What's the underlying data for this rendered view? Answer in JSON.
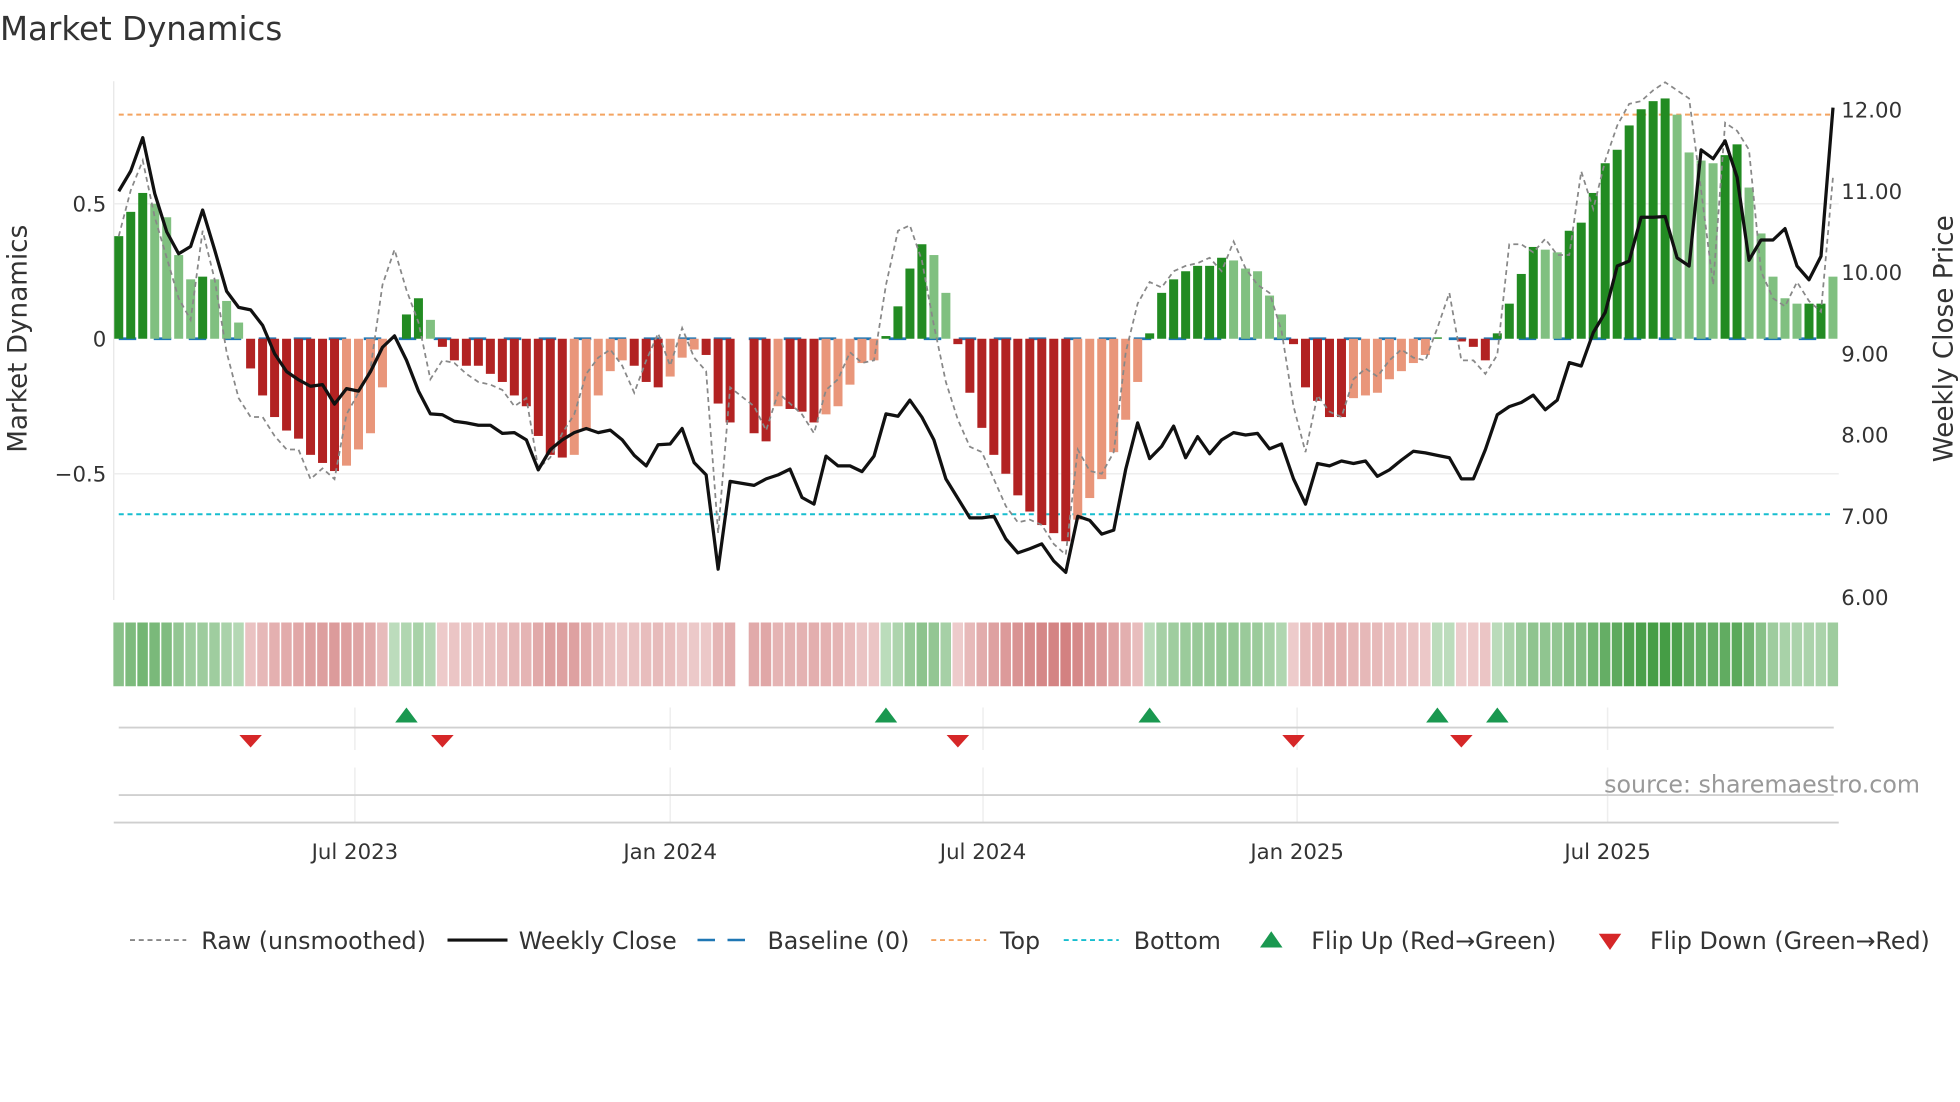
{
  "title": "Market Dynamics",
  "source_note": "source: sharemaestro.com",
  "colors": {
    "strong_up": "#228b22",
    "weak_up": "#80c080",
    "strong_down": "#b22222",
    "weak_down": "#e9967a",
    "raw": "#888888",
    "close": "#111111",
    "baseline": "#1f77b4",
    "top": "#f4a460",
    "bottom": "#17becf",
    "flip_up": "#1a9850",
    "flip_down": "#d62728"
  },
  "legend": {
    "raw": "Raw (unsmoothed)",
    "close": "Weekly Close",
    "baseline": "Baseline (0)",
    "top": "Top",
    "bottom": "Bottom",
    "flip_up": "Flip Up (Red→Green)",
    "flip_down": "Flip Down (Green→Red)"
  },
  "chart_data": {
    "type": "bar",
    "title": "Market Dynamics",
    "ylabel": "Market Dynamics",
    "y2label": "Weekly Close Price",
    "ylim": [
      -0.97,
      0.95
    ],
    "y2lim": [
      6.0,
      12.4
    ],
    "yticks": [
      {
        "v": 0.5,
        "label": "0.5"
      },
      {
        "v": 0,
        "label": "0"
      },
      {
        "v": -0.5,
        "label": "−0.5"
      }
    ],
    "y2ticks": [
      {
        "v": 12,
        "label": "12.00"
      },
      {
        "v": 11,
        "label": "11.00"
      },
      {
        "v": 10,
        "label": "10.00"
      },
      {
        "v": 9,
        "label": "9.00"
      },
      {
        "v": 8,
        "label": "8.00"
      },
      {
        "v": 7,
        "label": "7.00"
      },
      {
        "v": 6,
        "label": "6.00"
      }
    ],
    "xticks": [
      {
        "week": 19.7,
        "label": "Jul 2023"
      },
      {
        "week": 46.0,
        "label": "Jan 2024"
      },
      {
        "week": 72.1,
        "label": "Jul 2024"
      },
      {
        "week": 98.3,
        "label": "Jan 2025"
      },
      {
        "week": 124.2,
        "label": "Jul 2025"
      }
    ],
    "top_level": 0.83,
    "bottom_level": -0.65,
    "baseline": 0,
    "dynamics": [
      0.38,
      0.47,
      0.54,
      0.5,
      0.45,
      0.31,
      0.22,
      0.23,
      0.22,
      0.14,
      0.06,
      -0.11,
      -0.21,
      -0.29,
      -0.34,
      -0.37,
      -0.43,
      -0.46,
      -0.49,
      -0.47,
      -0.41,
      -0.35,
      -0.18,
      0,
      0.09,
      0.15,
      0.07,
      -0.03,
      -0.08,
      -0.1,
      -0.1,
      -0.13,
      -0.16,
      -0.21,
      -0.25,
      -0.36,
      -0.43,
      -0.44,
      -0.43,
      -0.34,
      -0.21,
      -0.12,
      -0.08,
      -0.1,
      -0.16,
      -0.18,
      -0.14,
      -0.07,
      -0.04,
      -0.06,
      -0.24,
      -0.31,
      null,
      -0.35,
      -0.38,
      -0.25,
      -0.26,
      -0.27,
      -0.31,
      -0.28,
      -0.25,
      -0.17,
      -0.09,
      -0.08,
      0.01,
      0.12,
      0.26,
      0.35,
      0.31,
      0.17,
      -0.02,
      -0.2,
      -0.33,
      -0.43,
      -0.5,
      -0.58,
      -0.64,
      -0.69,
      -0.72,
      -0.75,
      -0.67,
      -0.59,
      -0.52,
      -0.42,
      -0.3,
      -0.16,
      0.02,
      0.17,
      0.22,
      0.25,
      0.27,
      0.27,
      0.3,
      0.29,
      0.26,
      0.25,
      0.16,
      0.09,
      -0.02,
      -0.18,
      -0.23,
      -0.29,
      -0.29,
      -0.22,
      -0.21,
      -0.2,
      -0.15,
      -0.12,
      -0.09,
      -0.06,
      0.005,
      0,
      -0.01,
      -0.03,
      -0.08,
      0.02,
      0.13,
      0.24,
      0.34,
      0.33,
      0.32,
      0.4,
      0.43,
      0.54,
      0.65,
      0.7,
      0.79,
      0.85,
      0.88,
      0.89,
      0.83,
      0.69,
      0.66,
      0.65,
      0.68,
      0.72,
      0.56,
      0.39,
      0.23,
      0.15,
      0.13,
      0.13,
      0.13,
      0.23
    ],
    "bar_class": "GGGggggGgggRRRRRRRRrrrr-GGgRRRRRRRRRRRrrrrrRRRrrrRRR-RRrRRRrrrrrGGGGggRRRRRRRRRRrrrrrrGGGGGGGgggggRRRRRrrrrrrrG-RRRGGGGggGGGGGGGGGggggGGgggggGG",
    "raw": [
      0.38,
      0.55,
      0.66,
      0.45,
      0.3,
      0.15,
      0.07,
      0.4,
      0.22,
      -0.05,
      -0.22,
      -0.29,
      -0.29,
      -0.36,
      -0.41,
      -0.41,
      -0.52,
      -0.48,
      -0.52,
      -0.28,
      -0.2,
      -0.11,
      0.2,
      0.33,
      0.18,
      0.06,
      -0.15,
      -0.08,
      -0.09,
      -0.13,
      -0.16,
      -0.17,
      -0.19,
      -0.25,
      -0.22,
      -0.48,
      -0.44,
      -0.35,
      -0.28,
      -0.13,
      -0.07,
      -0.04,
      -0.1,
      -0.2,
      -0.08,
      0.02,
      -0.1,
      0.04,
      -0.07,
      -0.12,
      -0.72,
      -0.18,
      null,
      -0.25,
      -0.34,
      -0.2,
      -0.24,
      -0.28,
      -0.35,
      -0.19,
      -0.15,
      -0.05,
      -0.09,
      -0.08,
      0.2,
      0.4,
      0.42,
      0.29,
      0.05,
      -0.16,
      -0.3,
      -0.4,
      -0.42,
      -0.52,
      -0.62,
      -0.68,
      -0.67,
      -0.69,
      -0.76,
      -0.8,
      -0.41,
      -0.49,
      -0.5,
      -0.42,
      -0.05,
      0.13,
      0.21,
      0.19,
      0.25,
      0.27,
      0.28,
      0.3,
      0.25,
      0.36,
      0.26,
      0.2,
      0.17,
      0.03,
      -0.25,
      -0.42,
      -0.21,
      -0.27,
      -0.29,
      -0.15,
      -0.11,
      -0.14,
      -0.08,
      -0.04,
      -0.07,
      -0.08,
      0.04,
      0.17,
      -0.08,
      -0.08,
      -0.13,
      -0.06,
      0.35,
      0.35,
      0.32,
      0.37,
      0.31,
      0.31,
      0.62,
      0.48,
      0.66,
      0.79,
      0.87,
      0.88,
      0.92,
      0.95,
      0.92,
      0.89,
      0.55,
      0.2,
      0.8,
      0.77,
      0.7,
      0.25,
      0.15,
      0.12,
      0.21,
      0.14,
      0.1,
      0.6
    ],
    "close": [
      11.0,
      11.25,
      11.66,
      10.97,
      10.5,
      10.23,
      10.32,
      10.77,
      10.28,
      9.77,
      9.57,
      9.54,
      9.35,
      9.0,
      8.78,
      8.68,
      8.6,
      8.62,
      8.38,
      8.57,
      8.54,
      8.78,
      9.08,
      9.22,
      8.92,
      8.54,
      8.26,
      8.25,
      8.17,
      8.15,
      8.12,
      8.12,
      8.02,
      8.03,
      7.94,
      7.57,
      7.82,
      7.94,
      8.03,
      8.08,
      8.03,
      8.06,
      7.94,
      7.75,
      7.62,
      7.88,
      7.89,
      8.08,
      7.66,
      7.51,
      6.35,
      7.43,
      null,
      7.38,
      7.46,
      7.51,
      7.58,
      7.23,
      7.15,
      7.74,
      7.62,
      7.62,
      7.55,
      7.74,
      8.26,
      8.23,
      8.43,
      8.22,
      7.94,
      7.46,
      7.22,
      6.98,
      6.98,
      7.0,
      6.72,
      6.55,
      6.6,
      6.66,
      6.45,
      6.31,
      7.0,
      6.95,
      6.78,
      6.83,
      7.58,
      8.15,
      7.71,
      7.86,
      8.11,
      7.72,
      7.98,
      7.77,
      7.94,
      8.03,
      8.0,
      8.02,
      7.83,
      7.89,
      7.46,
      7.15,
      7.65,
      7.62,
      7.68,
      7.65,
      7.68,
      7.49,
      7.57,
      7.69,
      7.8,
      7.78,
      7.75,
      7.72,
      7.46,
      7.46,
      7.82,
      8.25,
      8.35,
      8.4,
      8.49,
      8.31,
      8.43,
      8.89,
      8.85,
      9.26,
      9.51,
      10.08,
      10.14,
      10.68,
      10.68,
      10.69,
      10.18,
      10.08,
      11.51,
      11.4,
      11.62,
      11.17,
      10.15,
      10.4,
      10.4,
      10.54,
      10.08,
      9.91,
      10.2,
      12.03
    ],
    "flip_up_weeks": [
      24,
      64,
      86,
      110,
      115
    ],
    "flip_down_weeks": [
      11,
      27,
      70,
      98,
      112
    ]
  }
}
